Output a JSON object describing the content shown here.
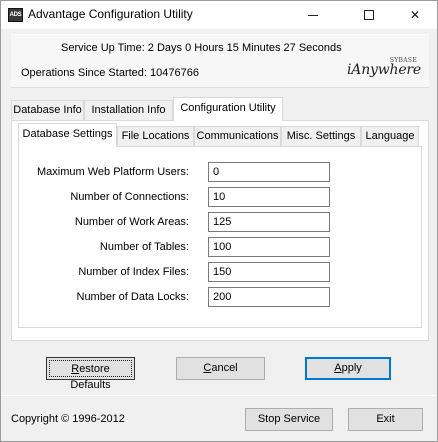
{
  "window": {
    "title": "Advantage Configuration Utility",
    "icon_text": "ADS"
  },
  "title_buttons": {
    "minimize_icon": "minimize-icon",
    "maximize_icon": "maximize-icon",
    "close_icon": "close-icon",
    "close_glyph": "✕"
  },
  "status": {
    "uptime": "Service Up Time:  2 Days 0 Hours 15 Minutes 27 Seconds",
    "operations": "Operations Since Started: 10476766"
  },
  "logo": {
    "line1": "SYBASE",
    "line2": "iAnywhere"
  },
  "outer_tabs": [
    {
      "label": "Database Info",
      "active": false
    },
    {
      "label": "Installation Info",
      "active": false
    },
    {
      "label": "Configuration Utility",
      "active": true
    }
  ],
  "inner_tabs": [
    {
      "label": "Database Settings",
      "active": true
    },
    {
      "label": "File Locations",
      "active": false
    },
    {
      "label": "Communications",
      "active": false
    },
    {
      "label": "Misc. Settings",
      "active": false
    },
    {
      "label": "Language",
      "active": false
    }
  ],
  "settings": [
    {
      "label": "Maximum Web Platform Users:",
      "value": "0"
    },
    {
      "label": "Number of Connections:",
      "value": "10"
    },
    {
      "label": "Number of Work Areas:",
      "value": "125"
    },
    {
      "label": "Number of Tables:",
      "value": "100"
    },
    {
      "label": "Number of Index Files:",
      "value": "150"
    },
    {
      "label": "Number of Data Locks:",
      "value": "200"
    }
  ],
  "buttons": {
    "restore_first": "R",
    "restore_rest": "estore Defaults",
    "cancel_first": "C",
    "cancel_rest": "ancel",
    "apply_first": "A",
    "apply_rest": "pply",
    "stop": "Stop Service",
    "exit": "Exit"
  },
  "footer": {
    "copyright": "Copyright © 1996-2012"
  }
}
